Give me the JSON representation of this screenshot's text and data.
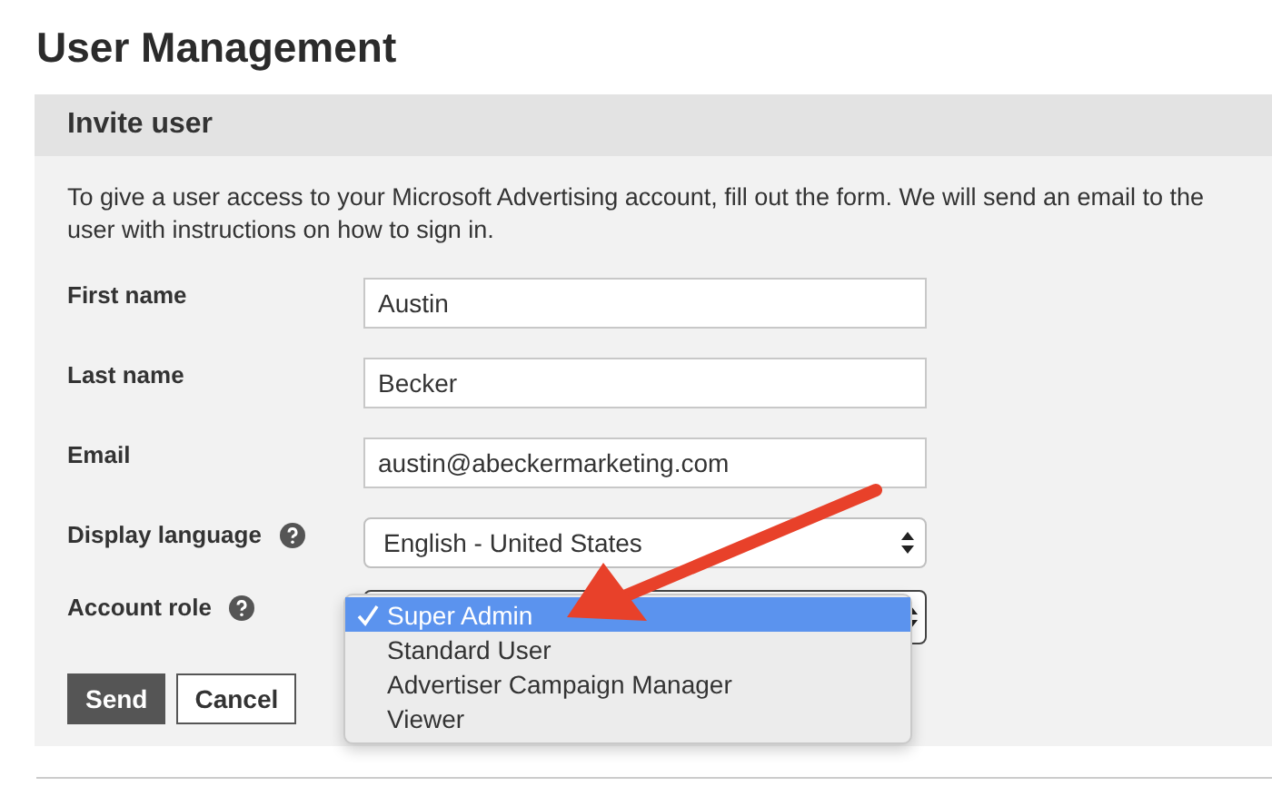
{
  "page_title": "User Management",
  "panel": {
    "title": "Invite user",
    "description": "To give a user access to your Microsoft Advertising account, fill out the form. We will send an email to the user with instructions on how to sign in."
  },
  "fields": [
    {
      "kind": "text",
      "label": "First name",
      "help": false,
      "value": "Austin"
    },
    {
      "kind": "text",
      "label": "Last name",
      "help": false,
      "value": "Becker"
    },
    {
      "kind": "text",
      "label": "Email",
      "help": false,
      "value": "austin@abeckermarketing.com"
    },
    {
      "kind": "select",
      "label": "Display language",
      "help": true,
      "value": "English - United States"
    },
    {
      "kind": "dropdown",
      "label": "Account role",
      "help": true,
      "options": [
        {
          "label": "Super Admin",
          "selected": true
        },
        {
          "label": "Standard User",
          "selected": false
        },
        {
          "label": "Advertiser Campaign Manager",
          "selected": false
        },
        {
          "label": "Viewer",
          "selected": false
        }
      ]
    }
  ],
  "buttons": [
    {
      "kind": "primary",
      "label": "Send"
    },
    {
      "kind": "secondary",
      "label": "Cancel"
    }
  ]
}
